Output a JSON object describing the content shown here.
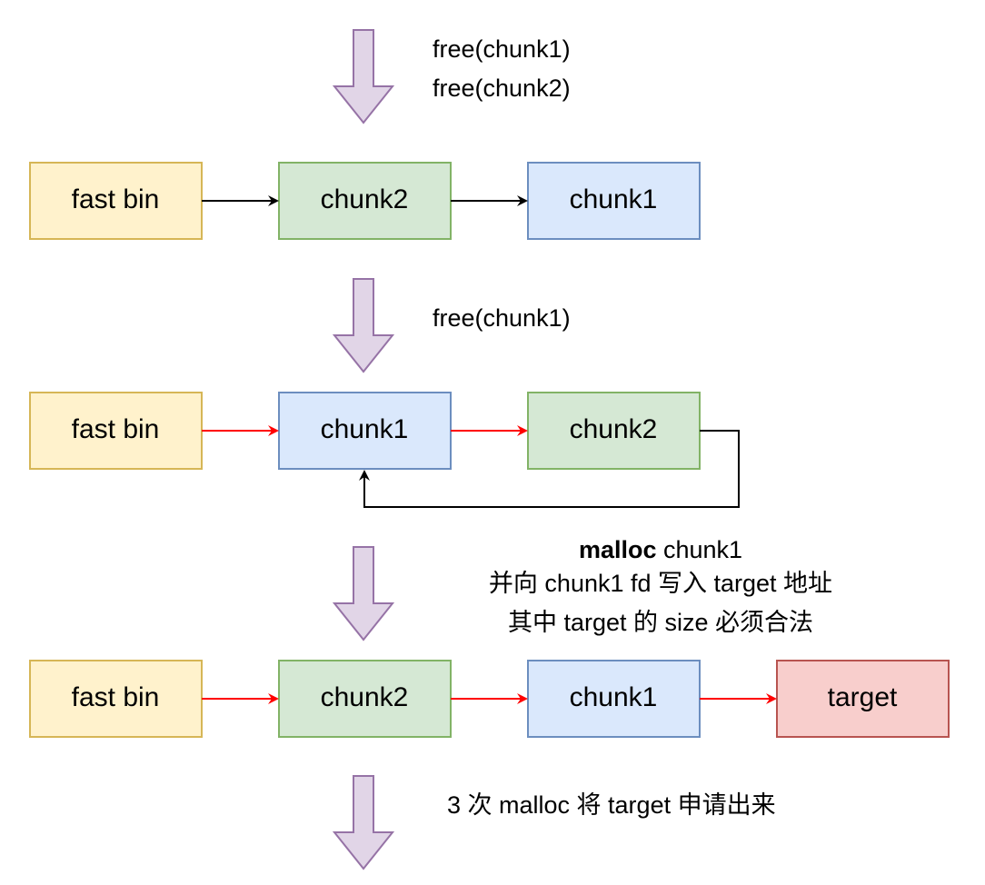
{
  "colors": {
    "fastbin_fill": "#fff2cc",
    "fastbin_stroke": "#d6b656",
    "green_fill": "#d5e8d4",
    "green_stroke": "#82b366",
    "blue_fill": "#dae8fc",
    "blue_stroke": "#6c8ebf",
    "red_fill": "#f8cecc",
    "red_stroke": "#b85450",
    "flow_arrow_fill": "#e1d5e7",
    "flow_arrow_stroke": "#9673a6",
    "link_black": "#000000",
    "link_red": "#ff0000"
  },
  "step1": {
    "note_line1": "free(chunk1)",
    "note_line2": "free(chunk2)",
    "boxes": [
      "fast bin",
      "chunk2",
      "chunk1"
    ]
  },
  "step2": {
    "note": "free(chunk1)",
    "boxes": [
      "fast bin",
      "chunk1",
      "chunk2"
    ]
  },
  "step3": {
    "note_bold": "malloc",
    "note_line1_rest": " chunk1",
    "note_line2": "并向 chunk1 fd 写入 target 地址",
    "note_line3": "其中 target 的 size 必须合法",
    "boxes": [
      "fast bin",
      "chunk2",
      "chunk1",
      "target"
    ]
  },
  "step4": {
    "note": "3 次 malloc 将 target 申请出来"
  }
}
